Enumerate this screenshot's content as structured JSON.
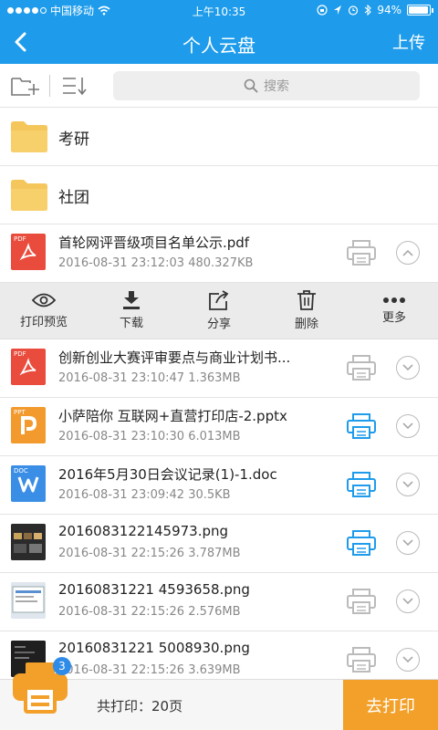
{
  "status_bar": {
    "carrier": "中国移动",
    "time": "上午10:35",
    "battery": "94%",
    "battery_level": 0.94
  },
  "nav": {
    "title": "个人云盘",
    "upload_label": "上传"
  },
  "toolbar": {
    "search_placeholder": "搜索"
  },
  "folders": [
    {
      "name": "考研"
    },
    {
      "name": "社团"
    }
  ],
  "files": [
    {
      "name": "首轮网评晋级项目名单公示.pdf",
      "meta": "2016-08-31 23:12:03 480.327KB",
      "type": "PDF",
      "type_label": "PDF",
      "printer": "gray",
      "expanded": true
    },
    {
      "name": "创新创业大赛评审要点与商业计划书...",
      "meta": "2016-08-31 23:10:47 1.363MB",
      "type": "PDF",
      "type_label": "PDF",
      "printer": "gray",
      "expanded": false
    },
    {
      "name": "小萨陪你 互联网+直营打印店-2.pptx",
      "meta": "2016-08-31 23:10:30 6.013MB",
      "type": "PPT",
      "type_label": "PPT",
      "printer": "blue",
      "expanded": false
    },
    {
      "name": "2016年5月30日会议记录(1)-1.doc",
      "meta": "2016-08-31 23:09:42 30.5KB",
      "type": "DOC",
      "type_label": "DOC",
      "printer": "blue",
      "expanded": false
    },
    {
      "name": "2016083122145973.png",
      "meta": "2016-08-31 22:15:26 3.787MB",
      "type": "IMG",
      "printer": "blue",
      "expanded": false
    },
    {
      "name": "20160831221 4593658.png",
      "meta": "2016-08-31 22:15:26 2.576MB",
      "type": "IMG",
      "printer": "gray",
      "expanded": false
    },
    {
      "name": "20160831221 5008930.png",
      "meta": "2016-08-31 22:15:26 3.639MB",
      "type": "IMG",
      "printer": "gray",
      "expanded": false
    }
  ],
  "actions": [
    {
      "label": "打印预览",
      "icon": "eye-icon"
    },
    {
      "label": "下载",
      "icon": "download-icon"
    },
    {
      "label": "分享",
      "icon": "share-icon"
    },
    {
      "label": "删除",
      "icon": "trash-icon"
    },
    {
      "label": "更多",
      "icon": "more-icon"
    }
  ],
  "bottom": {
    "print_summary": "共打印：20页",
    "go_print_label": "去打印",
    "badge_count": "3"
  },
  "colors": {
    "primary": "#1E9CEB",
    "orange": "#F2A02A",
    "pdf_red": "#E94B3C",
    "doc_blue": "#3A8EE6",
    "ppt_orange": "#F29A2E",
    "folder": "#F5C65C"
  }
}
